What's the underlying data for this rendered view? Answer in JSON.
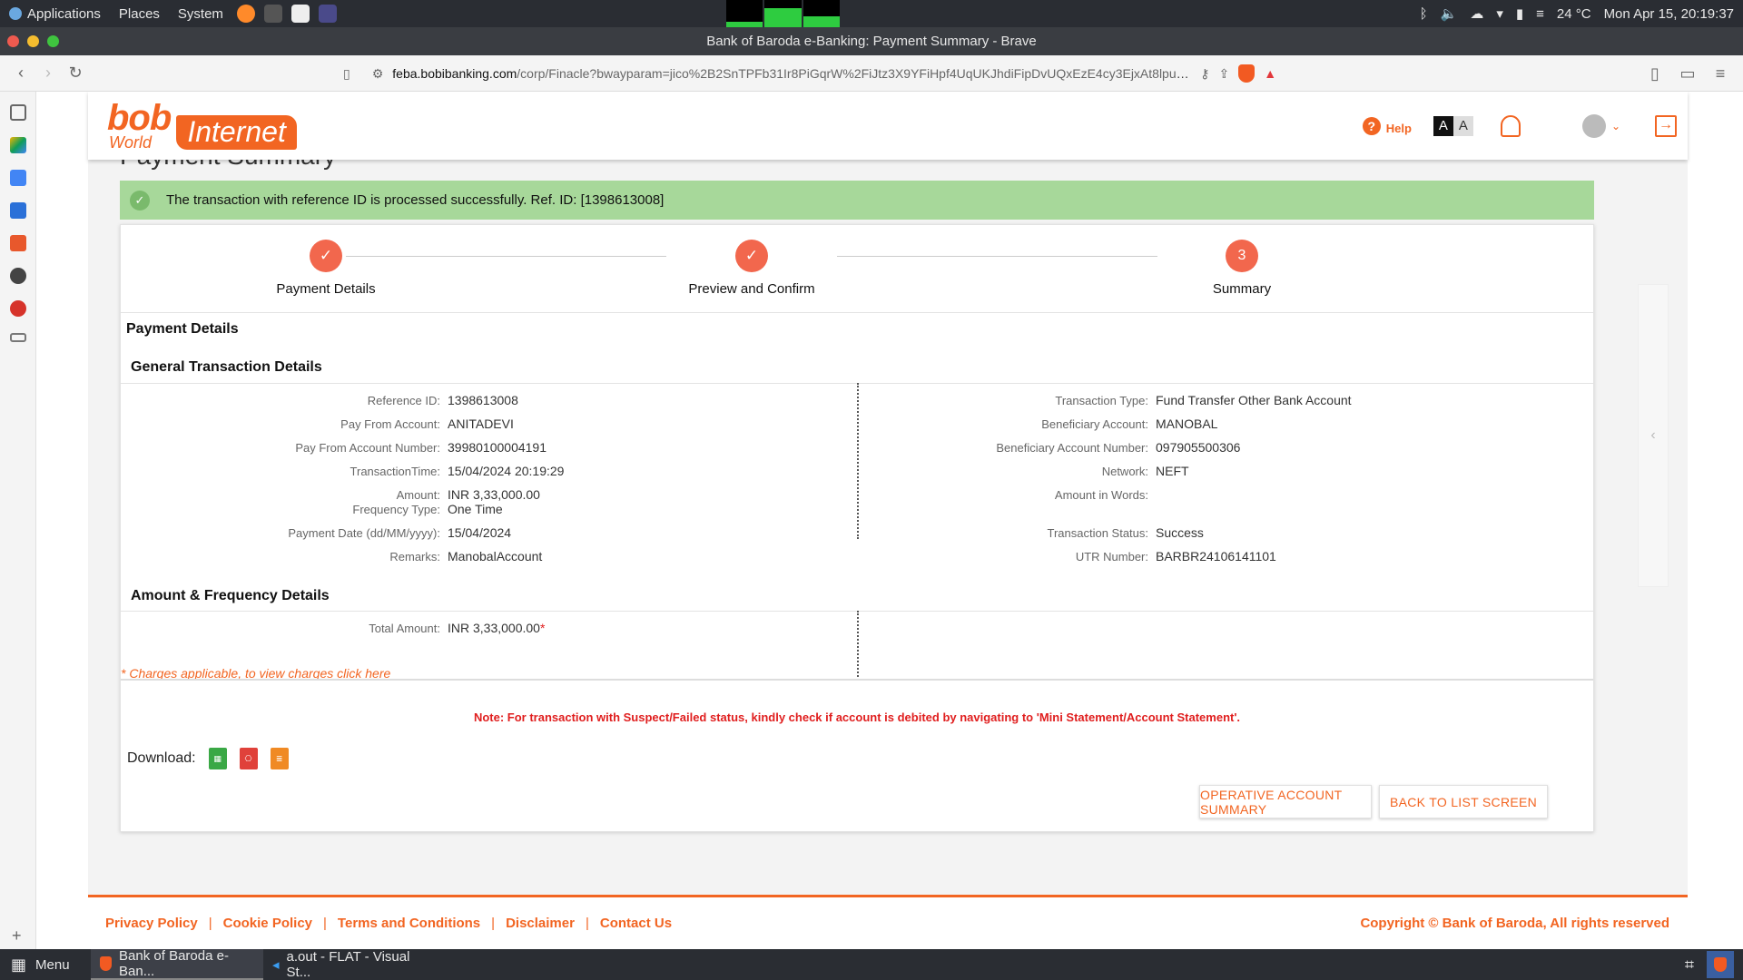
{
  "os": {
    "menu": [
      "Applications",
      "Places",
      "System"
    ],
    "temperature": "24 °C",
    "datetime": "Mon Apr 15, 20:19:37"
  },
  "window": {
    "title": "Bank of Baroda e-Banking: Payment Summary - Brave"
  },
  "browser": {
    "url_host": "feba.bobibanking.com",
    "url_path": "/corp/Finacle?bwayparam=jico%2B2SnTPFb31Ir8PiGqrW%2FiJtz3X9YFiHpf4UqUKJhdiFipDvUQxEzE4cy3EjxAt8lpusYc..."
  },
  "header": {
    "logo_bob": "bob",
    "logo_world": "World",
    "logo_internet": "Internet",
    "help_label": "Help",
    "font_large": "A",
    "font_small": "A"
  },
  "page": {
    "title": "Payment Summary",
    "success_message": "The transaction with reference ID is processed successfully. Ref. ID: [1398613008]"
  },
  "steps": [
    {
      "label": "Payment Details",
      "marker": "✓"
    },
    {
      "label": "Preview and Confirm",
      "marker": "✓"
    },
    {
      "label": "Summary",
      "marker": "3"
    }
  ],
  "details": {
    "section_title": "Payment Details",
    "general_title": "General Transaction Details",
    "left": [
      {
        "k": "Reference ID:",
        "v": "1398613008"
      },
      {
        "k": "Pay From Account:",
        "v": "ANITADEVI"
      },
      {
        "k": "Pay From Account Number:",
        "v": "39980100004191"
      },
      {
        "k": "TransactionTime:",
        "v": "15/04/2024 20:19:29"
      },
      {
        "k": "Amount:",
        "v": "INR 3,33,000.00"
      },
      {
        "k": "Frequency Type:",
        "v": "One Time"
      },
      {
        "k": "Payment Date (dd/MM/yyyy):",
        "v": "15/04/2024"
      },
      {
        "k": "Remarks:",
        "v": "ManobalAccount"
      }
    ],
    "right": [
      {
        "k": "Transaction Type:",
        "v": "Fund Transfer Other Bank Account"
      },
      {
        "k": "Beneficiary Account:",
        "v": "MANOBAL"
      },
      {
        "k": "Beneficiary Account Number:",
        "v": "097905500306"
      },
      {
        "k": "Network:",
        "v": "NEFT"
      },
      {
        "k": "Amount in Words:",
        "v": ""
      },
      {
        "k": "Transaction Status:",
        "v": "Success"
      },
      {
        "k": "UTR Number:",
        "v": "BARBR24106141101"
      }
    ],
    "amount_title": "Amount & Frequency Details",
    "total_label": "Total Amount:",
    "total_value": "INR 3,33,000.00",
    "total_mark": "*",
    "charges_link": "* Charges applicable, to view charges click here",
    "note": "Note: For transaction with Suspect/Failed status, kindly check if account is debited by navigating to 'Mini Statement/Account Statement'.",
    "download_label": "Download:",
    "btn_operative": "OPERATIVE ACCOUNT SUMMARY",
    "btn_back": "BACK TO LIST SCREEN"
  },
  "footer": {
    "links": [
      "Privacy Policy",
      "Cookie Policy",
      "Terms and Conditions",
      "Disclaimer",
      "Contact Us"
    ],
    "copyright": "Copyright © Bank of Baroda, All rights reserved"
  },
  "taskbar": {
    "menu_label": "Menu",
    "tasks": [
      "Bank of Baroda e-Ban...",
      "a.out - FLAT - Visual St..."
    ]
  },
  "colors": {
    "accent": "#f26522",
    "success_bg": "#a7d89a",
    "step": "#f2674d",
    "note": "#e01e1e"
  }
}
